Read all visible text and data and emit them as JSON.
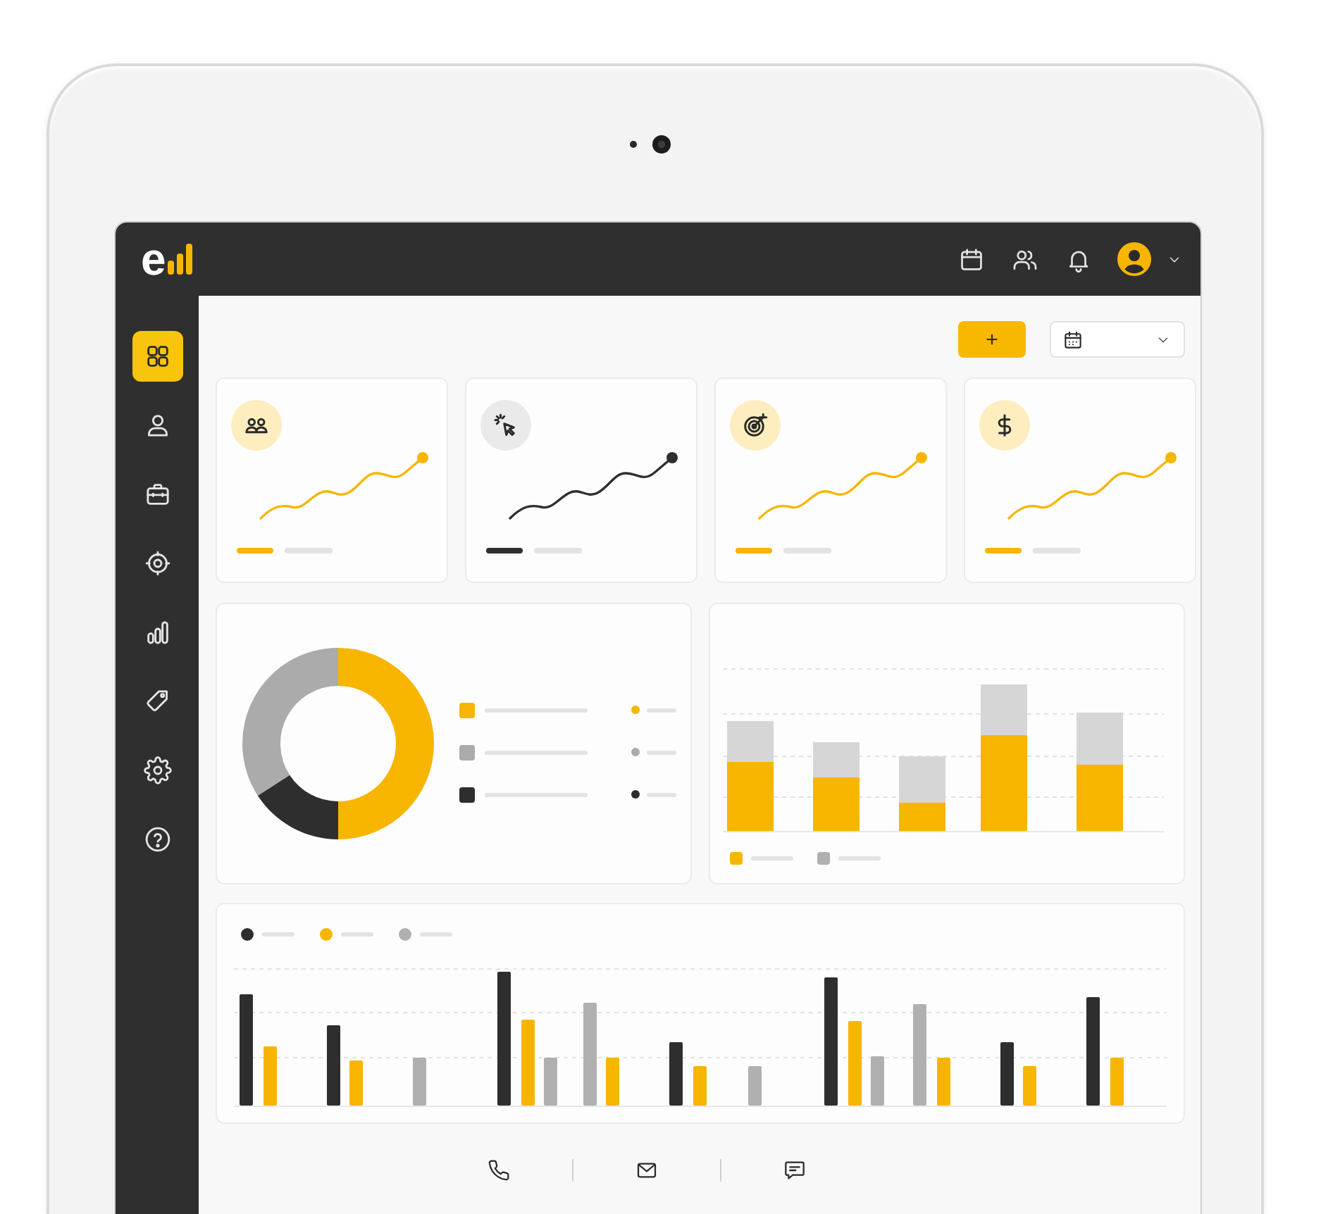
{
  "header": {
    "logo": "e"
  },
  "sidebar": {
    "items": [
      {
        "selected": true
      },
      {
        "selected": false
      },
      {
        "selected": false
      },
      {
        "selected": false
      },
      {
        "selected": false
      },
      {
        "selected": false
      },
      {
        "selected": false
      },
      {
        "selected": false
      }
    ]
  },
  "toolbar": {
    "add_button": "+"
  },
  "kpi_cards": [
    {
      "color": "#f7b500"
    },
    {
      "color": "#2e2e2e"
    },
    {
      "color": "#f7b500"
    },
    {
      "color": "#f7b500"
    }
  ],
  "donut_legend": [
    {
      "color": "#f7b500"
    },
    {
      "color": "#ababab"
    },
    {
      "color": "#2e2e2e"
    }
  ],
  "stacked_legend": [
    {
      "color": "#f7b500"
    },
    {
      "color": "#b0b0b0"
    }
  ],
  "grouped_legend": [
    {
      "color": "#2e2e2e"
    },
    {
      "color": "#f7b500"
    },
    {
      "color": "#b0b0b0"
    }
  ]
}
